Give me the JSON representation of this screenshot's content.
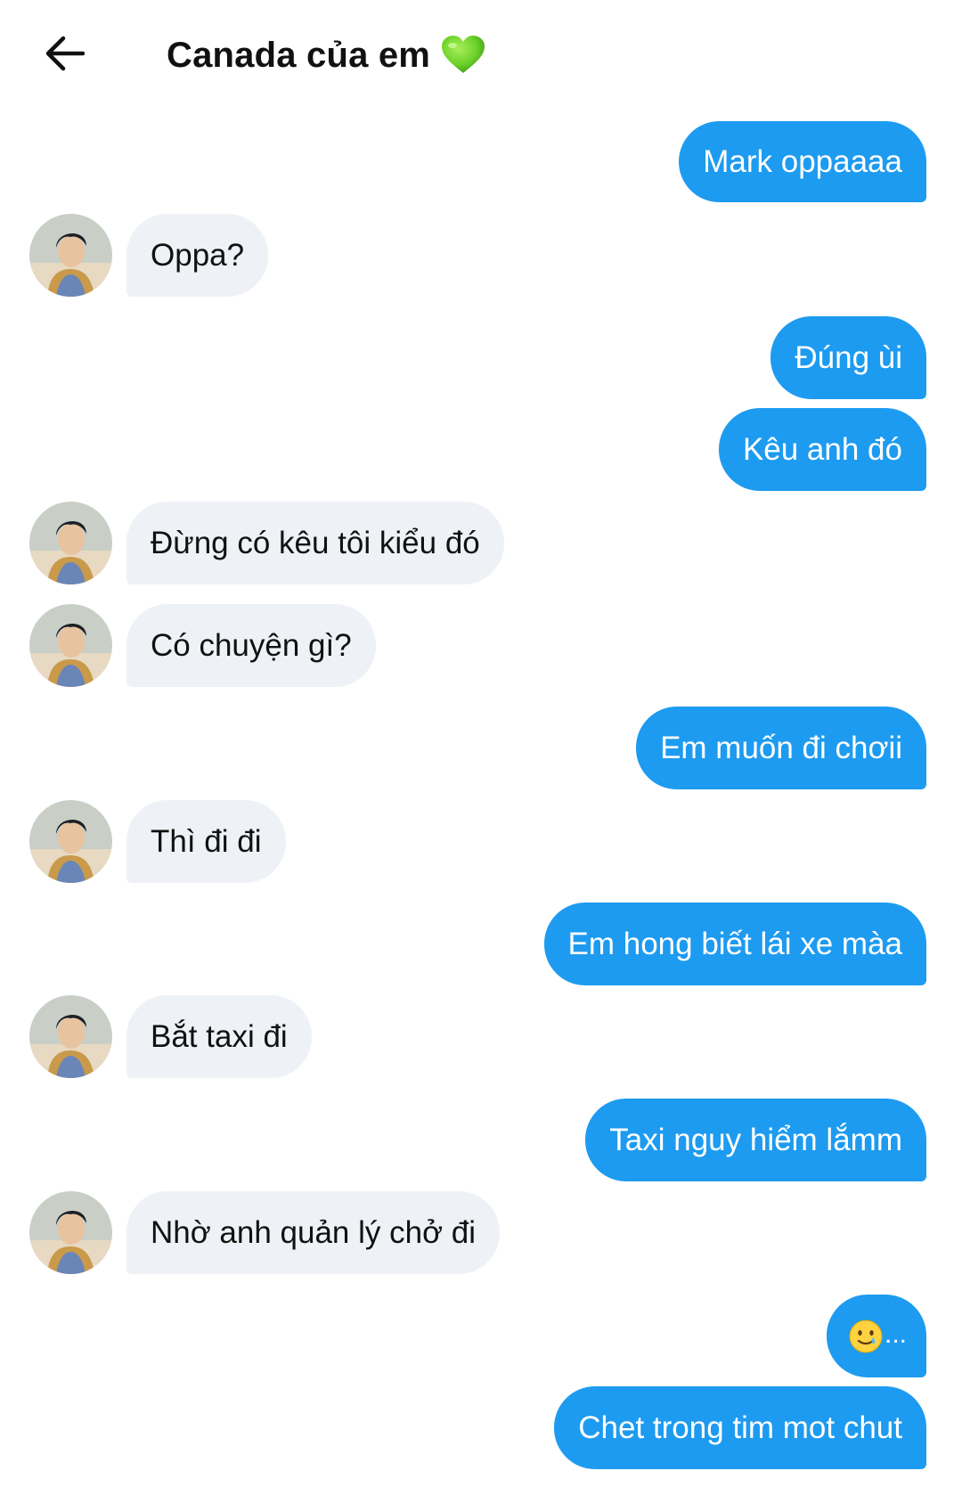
{
  "header": {
    "title": "Canada của em",
    "back_icon": "arrow-left-icon",
    "title_icon": "green-heart-icon"
  },
  "colors": {
    "outgoing_bubble": "#1d9bf0",
    "incoming_bubble": "#eef1f5",
    "heart": "#6cd12a"
  },
  "messages": [
    {
      "from": "me",
      "text": "Mark oppaaaa"
    },
    {
      "from": "them",
      "text": "Oppa?"
    },
    {
      "from": "me",
      "text": "Đúng ùi"
    },
    {
      "from": "me",
      "text": "Kêu anh đó"
    },
    {
      "from": "them",
      "text": "Đừng có kêu tôi kiểu đó"
    },
    {
      "from": "them",
      "text": "Có chuyện gì?"
    },
    {
      "from": "me",
      "text": "Em muốn đi chơii"
    },
    {
      "from": "them",
      "text": "Thì đi đi"
    },
    {
      "from": "me",
      "text": "Em hong biết lái xe màa"
    },
    {
      "from": "them",
      "text": "Bắt taxi đi"
    },
    {
      "from": "me",
      "text": "Taxi nguy hiểm lắmm"
    },
    {
      "from": "them",
      "text": "Nhờ anh quản lý chở đi"
    },
    {
      "from": "me",
      "text": "...",
      "emoji_icon": "smiling-face-with-tear-icon"
    },
    {
      "from": "me",
      "text": "Chet trong tim mot chut"
    }
  ]
}
